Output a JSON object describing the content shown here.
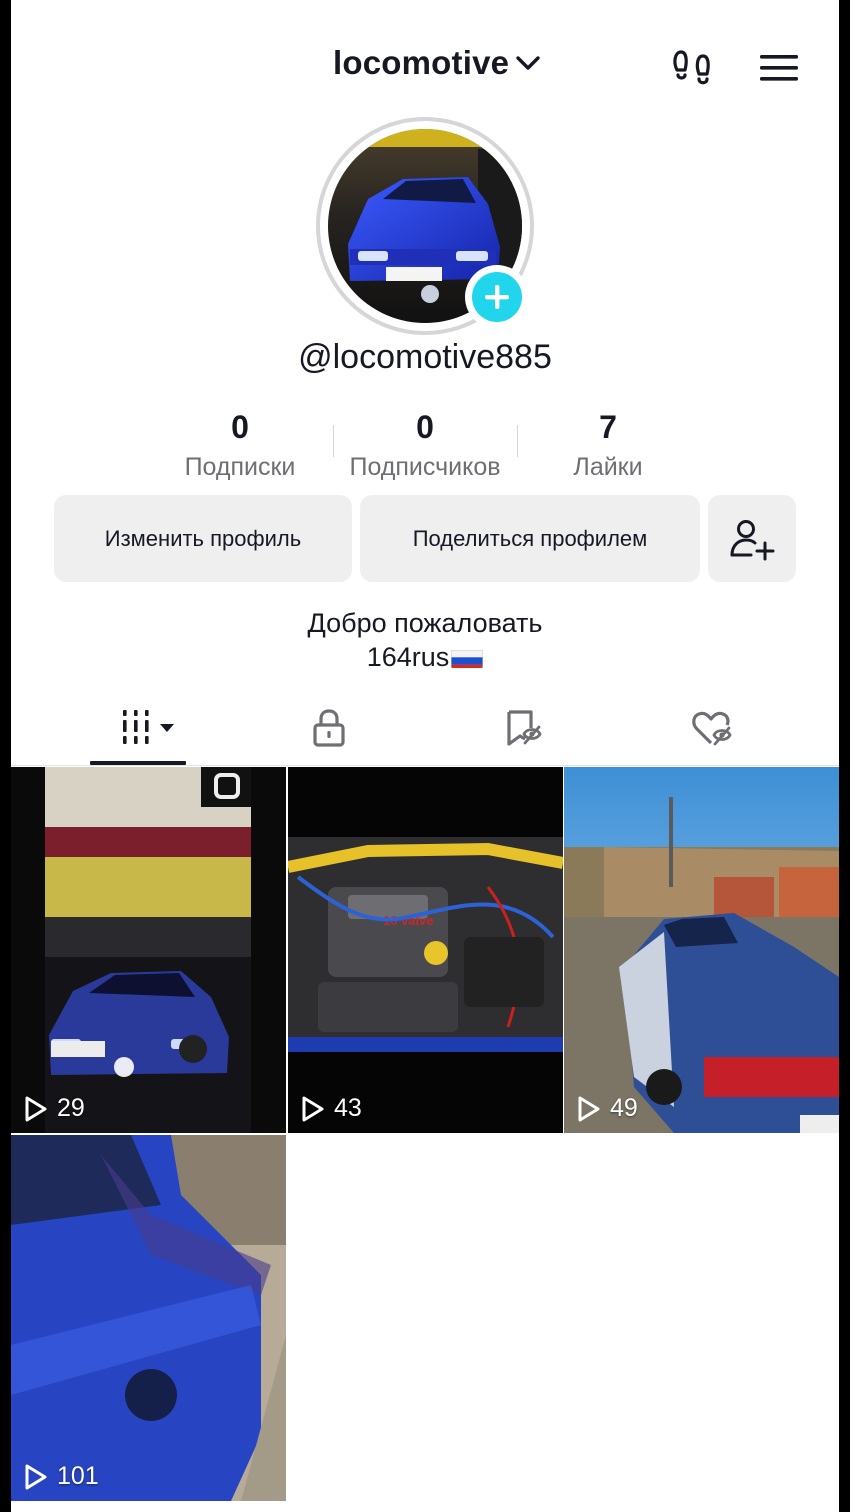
{
  "header": {
    "username": "locomotive",
    "footprints_icon": "footprints-icon",
    "menu_icon": "menu-icon"
  },
  "profile": {
    "handle": "@locomotive885",
    "add_icon": "plus-icon"
  },
  "stats": [
    {
      "value": "0",
      "label": "Подписки"
    },
    {
      "value": "0",
      "label": "Подписчиков"
    },
    {
      "value": "7",
      "label": "Лайки"
    }
  ],
  "actions": {
    "edit_profile": "Изменить профиль",
    "share_profile": "Поделиться профилем",
    "add_friend_icon": "add-user-icon"
  },
  "bio": {
    "line1": "Добро пожаловать",
    "line2": "164rus"
  },
  "tabs": [
    {
      "icon": "videos-grid-icon",
      "active": true
    },
    {
      "icon": "lock-icon",
      "active": false
    },
    {
      "icon": "favorites-icon",
      "active": false
    },
    {
      "icon": "liked-icon",
      "active": false
    }
  ],
  "videos": [
    {
      "views": "29"
    },
    {
      "views": "43"
    },
    {
      "views": "49"
    },
    {
      "views": "101"
    }
  ],
  "colors": {
    "accent": "#20d5ec",
    "text": "#161823",
    "muted": "#6e6f75",
    "button_bg": "#efefef"
  }
}
